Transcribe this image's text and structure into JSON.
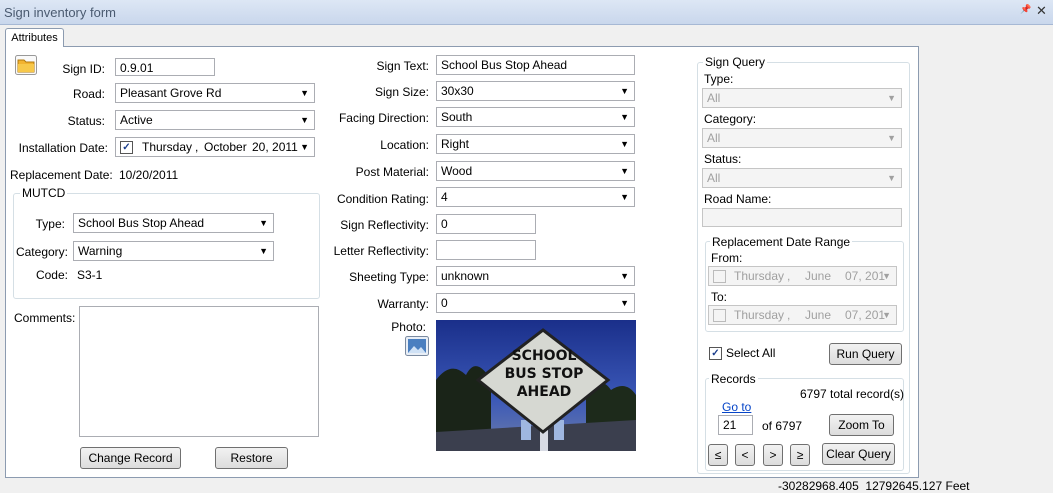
{
  "window": {
    "title": "Sign inventory form",
    "pin_glyph": "📌",
    "close_glyph": "✕"
  },
  "tabs": [
    {
      "label": "Attributes"
    }
  ],
  "left": {
    "sign_id_label": "Sign ID:",
    "sign_id_value": "0.9.01",
    "road_label": "Road:",
    "road_value": "Pleasant Grove Rd",
    "status_label": "Status:",
    "status_value": "Active",
    "install_label": "Installation Date:",
    "install_day": "Thursday",
    "install_sep1": ",",
    "install_month": "October",
    "install_date": "20, 2011",
    "replace_label": "Replacement Date:",
    "replace_value": "10/20/2011",
    "mutcd": {
      "title": "MUTCD",
      "type_label": "Type:",
      "type_value": "School Bus Stop Ahead",
      "category_label": "Category:",
      "category_value": "Warning",
      "code_label": "Code:",
      "code_value": "S3-1"
    },
    "comments_label": "Comments:",
    "comments_value": "",
    "change_button": "Change Record",
    "restore_button": "Restore"
  },
  "middle": {
    "sign_text_label": "Sign Text:",
    "sign_text_value": "School Bus Stop Ahead",
    "sign_size_label": "Sign Size:",
    "sign_size_value": "30x30",
    "facing_label": "Facing Direction:",
    "facing_value": "South",
    "location_label": "Location:",
    "location_value": "Right",
    "post_label": "Post Material:",
    "post_value": "Wood",
    "condition_label": "Condition Rating:",
    "condition_value": "4",
    "sign_refl_label": "Sign Reflectivity:",
    "sign_refl_value": "0",
    "letter_refl_label": "Letter Reflectivity:",
    "letter_refl_value": "",
    "sheeting_label": "Sheeting Type:",
    "sheeting_value": "unknown",
    "warranty_label": "Warranty:",
    "warranty_value": "0",
    "photo_label": "Photo:",
    "photo_sign_line1": "SCHOOL",
    "photo_sign_line2": "BUS STOP",
    "photo_sign_line3": "AHEAD"
  },
  "query": {
    "title": "Sign Query",
    "type_label": "Type:",
    "type_value": "All",
    "category_label": "Category:",
    "category_value": "All",
    "status_label": "Status:",
    "status_value": "All",
    "road_name_label": "Road Name:",
    "road_name_value": "",
    "range_title": "Replacement Date Range",
    "from_label": "From:",
    "from_day": "Thursday",
    "from_sep": ",",
    "from_month": "June",
    "from_date": "07, 201",
    "to_label": "To:",
    "to_day": "Thursday",
    "to_sep": ",",
    "to_month": "June",
    "to_date": "07, 201",
    "select_all_label": "Select All",
    "run_query_button": "Run Query"
  },
  "records": {
    "title": "Records",
    "total": "6797 total record(s)",
    "goto_link": "Go to",
    "goto_value": "21",
    "of_text": "of 6797",
    "zoom_button": "Zoom To",
    "first_button": "≤",
    "prev_button": "<",
    "next_button": ">",
    "last_button": "≥",
    "clear_button": "Clear Query"
  },
  "status_bar": {
    "coords": "-30282968.405  12792645.127 Feet"
  },
  "colors": {
    "title_text": "#4a5a70",
    "link": "#0645c8",
    "folder": "#f2b330"
  },
  "icons": [
    "folder-icon",
    "dropdown-arrow-icon",
    "photo-icon",
    "checkbox-icon",
    "pin-icon",
    "close-icon"
  ]
}
